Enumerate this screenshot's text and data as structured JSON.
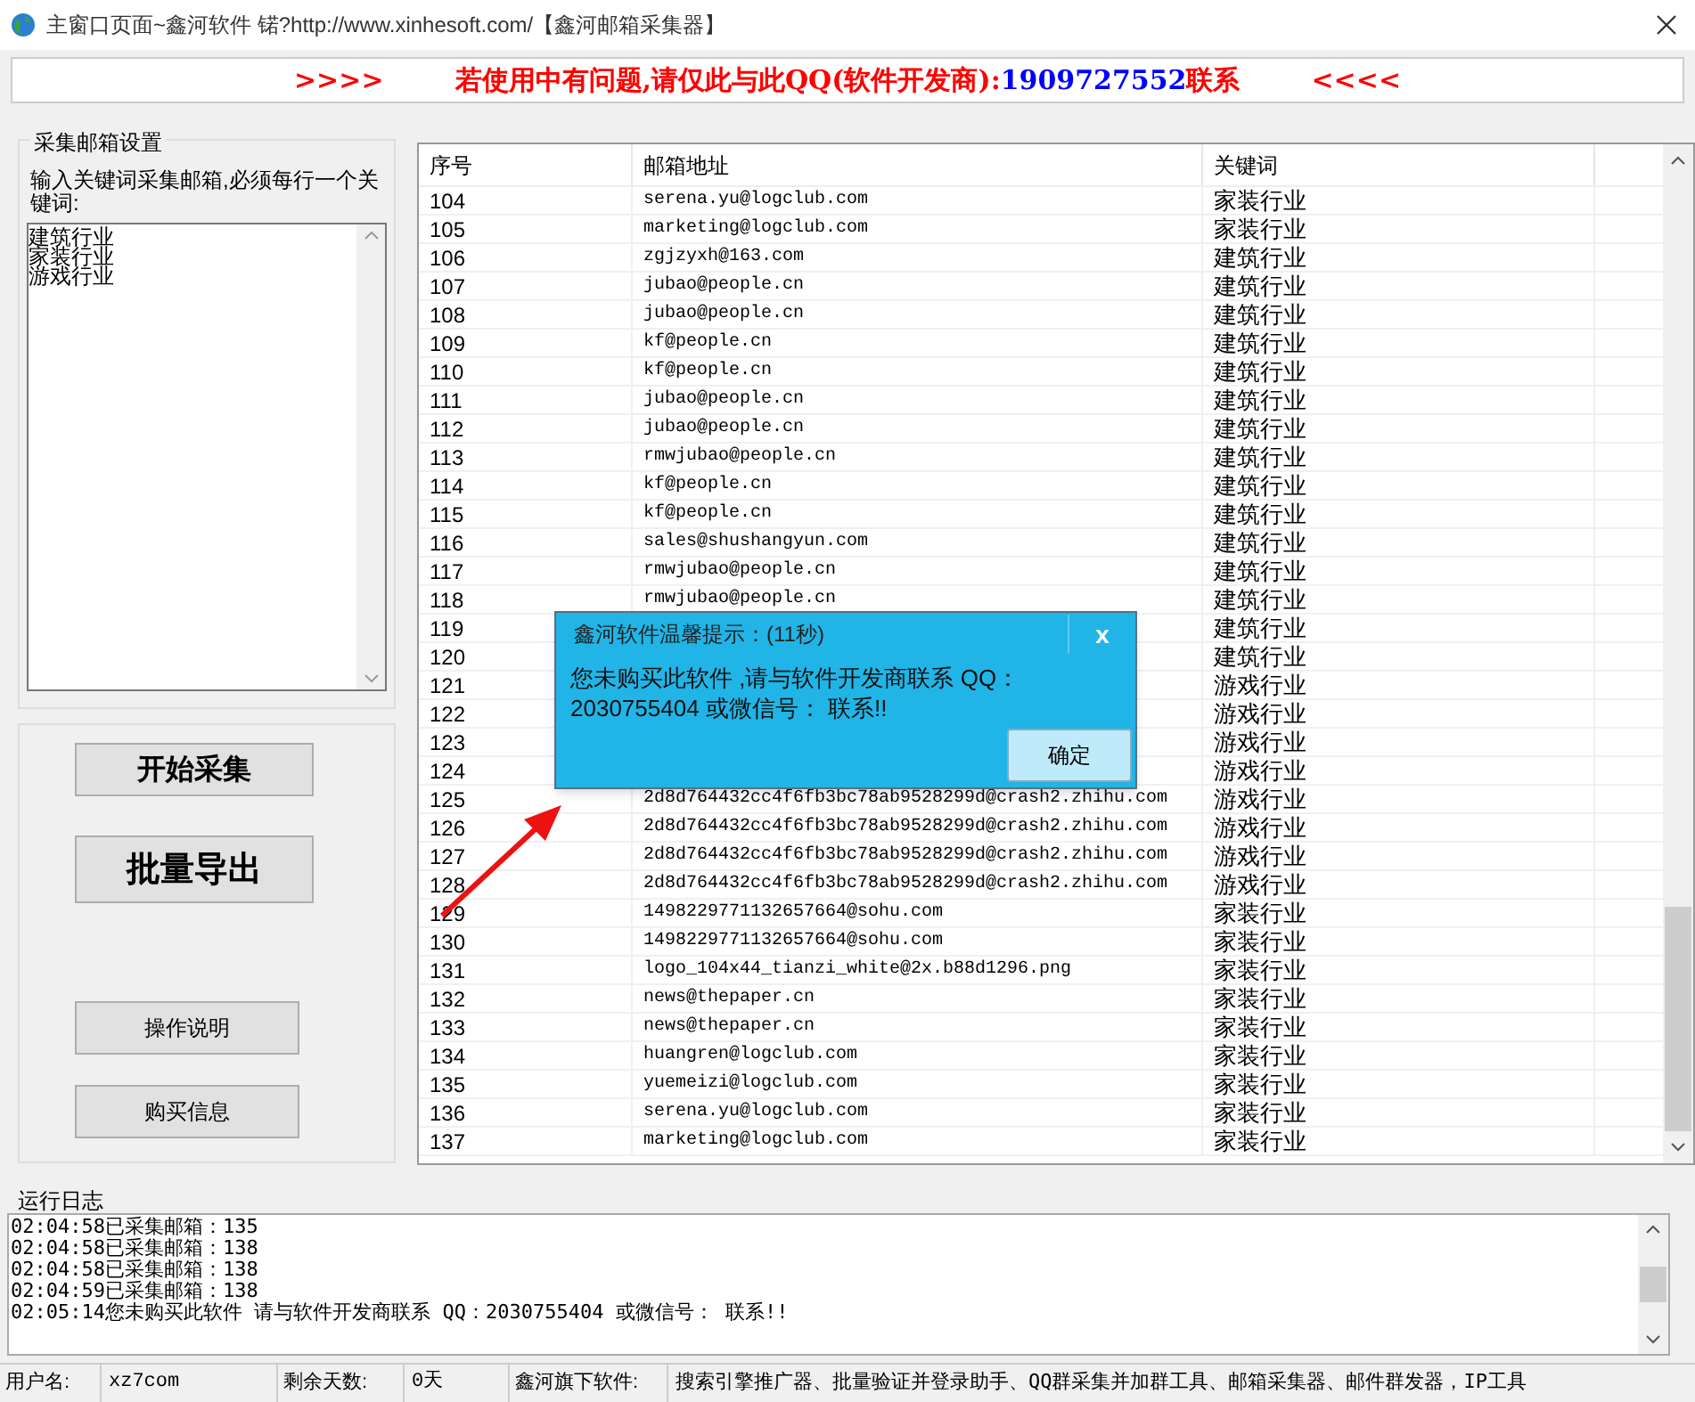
{
  "window": {
    "title": "主窗口页面~鑫河软件 锘?http://www.xinhesoft.com/【鑫河邮箱采集器】"
  },
  "banner": {
    "left": ">>>>",
    "message": "若使用中有问题,请仅此与此QQ(软件开发商):",
    "number": "1909727552",
    "suffix": "联系",
    "right": "<<<<"
  },
  "settings": {
    "title": "采集邮箱设置",
    "instruction": "输入关键词采集邮箱,必须每行一个关键词:",
    "keywords": [
      "建筑行业",
      "家装行业",
      "游戏行业"
    ]
  },
  "buttons": [
    {
      "label": "开始采集",
      "kind": "large"
    },
    {
      "label": "批量导出",
      "kind": "larger"
    },
    {
      "label": "操作说明",
      "kind": "small"
    },
    {
      "label": "购买信息",
      "kind": "small"
    }
  ],
  "table": {
    "columns": [
      "序号",
      "邮箱地址",
      "关键词"
    ],
    "rows": [
      {
        "no": "104",
        "email": "serena.yu@logclub.com",
        "keyword": "家装行业"
      },
      {
        "no": "105",
        "email": "marketing@logclub.com",
        "keyword": "家装行业"
      },
      {
        "no": "106",
        "email": "zgjzyxh@163.com",
        "keyword": "建筑行业"
      },
      {
        "no": "107",
        "email": "jubao@people.cn",
        "keyword": "建筑行业"
      },
      {
        "no": "108",
        "email": "jubao@people.cn",
        "keyword": "建筑行业"
      },
      {
        "no": "109",
        "email": "kf@people.cn",
        "keyword": "建筑行业"
      },
      {
        "no": "110",
        "email": "kf@people.cn",
        "keyword": "建筑行业"
      },
      {
        "no": "111",
        "email": "jubao@people.cn",
        "keyword": "建筑行业"
      },
      {
        "no": "112",
        "email": "jubao@people.cn",
        "keyword": "建筑行业"
      },
      {
        "no": "113",
        "email": "rmwjubao@people.cn",
        "keyword": "建筑行业"
      },
      {
        "no": "114",
        "email": "kf@people.cn",
        "keyword": "建筑行业"
      },
      {
        "no": "115",
        "email": "kf@people.cn",
        "keyword": "建筑行业"
      },
      {
        "no": "116",
        "email": "sales@shushangyun.com",
        "keyword": "建筑行业"
      },
      {
        "no": "117",
        "email": "rmwjubao@people.cn",
        "keyword": "建筑行业"
      },
      {
        "no": "118",
        "email": "rmwjubao@people.cn",
        "keyword": "建筑行业"
      },
      {
        "no": "119",
        "keyword": "建筑行业"
      },
      {
        "no": "120",
        "keyword": "建筑行业"
      },
      {
        "no": "121",
        "keyword": "游戏行业"
      },
      {
        "no": "122",
        "keyword": "游戏行业"
      },
      {
        "no": "123",
        "keyword": "游戏行业"
      },
      {
        "no": "124",
        "keyword": "游戏行业"
      },
      {
        "no": "125",
        "email": "2d8d764432cc4f6fb3bc78ab9528299d@crash2.zhihu.com",
        "keyword": "游戏行业"
      },
      {
        "no": "126",
        "email": "2d8d764432cc4f6fb3bc78ab9528299d@crash2.zhihu.com",
        "keyword": "游戏行业"
      },
      {
        "no": "127",
        "email": "2d8d764432cc4f6fb3bc78ab9528299d@crash2.zhihu.com",
        "keyword": "游戏行业"
      },
      {
        "no": "128",
        "email": "2d8d764432cc4f6fb3bc78ab9528299d@crash2.zhihu.com",
        "keyword": "游戏行业"
      },
      {
        "no": "129",
        "email": "1498229771132657664@sohu.com",
        "keyword": "家装行业"
      },
      {
        "no": "130",
        "email": "1498229771132657664@sohu.com",
        "keyword": "家装行业"
      },
      {
        "no": "131",
        "email": "logo_104x44_tianzi_white@2x.b88d1296.png",
        "keyword": "家装行业"
      },
      {
        "no": "132",
        "email": "news@thepaper.cn",
        "keyword": "家装行业"
      },
      {
        "no": "133",
        "email": "news@thepaper.cn",
        "keyword": "家装行业"
      },
      {
        "no": "134",
        "email": "huangren@logclub.com",
        "keyword": "家装行业"
      },
      {
        "no": "135",
        "email": "yuemeizi@logclub.com",
        "keyword": "家装行业"
      },
      {
        "no": "136",
        "email": "serena.yu@logclub.com",
        "keyword": "家装行业"
      },
      {
        "no": "137",
        "email": "marketing@logclub.com",
        "keyword": "家装行业"
      }
    ]
  },
  "dialog": {
    "title": "鑫河软件温馨提示：(11秒)",
    "close": "x",
    "message": "您未购买此软件 ,请与软件开发商联系 QQ：2030755404 或微信号： 联系!!",
    "button": "确定"
  },
  "log": {
    "title": "运行日志",
    "lines": [
      "02:04:58已采集邮箱：135",
      "02:04:58已采集邮箱：138",
      "02:04:58已采集邮箱：138",
      "02:04:59已采集邮箱：138",
      "02:05:14您未购买此软件 请与软件开发商联系 QQ：2030755404 或微信号： 联系!!"
    ]
  },
  "status_bar": [
    {
      "label": "用户名:",
      "value": "xz7com"
    },
    {
      "label": "剩余天数:",
      "value": "0天"
    },
    {
      "label": "鑫河旗下软件:",
      "value": "搜索引擎推广器、批量验证并登录助手、QQ群采集并加群工具、邮箱采集器、邮件群发器，IP工具"
    }
  ]
}
